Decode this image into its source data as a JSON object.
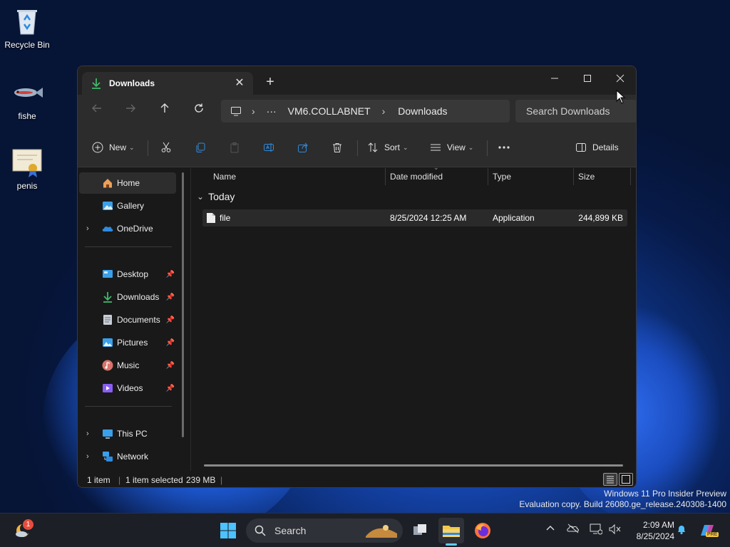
{
  "desktop": {
    "icons": [
      {
        "label": "Recycle Bin",
        "icon": "recycle-bin-icon"
      },
      {
        "label": "fishe",
        "icon": "fish-icon"
      },
      {
        "label": "penis",
        "icon": "certificate-icon"
      }
    ]
  },
  "window": {
    "tab_title": "Downloads",
    "address": {
      "computer": "VM6.COLLABNET",
      "folder": "Downloads",
      "overflow": "···"
    },
    "search_placeholder": "Search Downloads"
  },
  "toolbar": {
    "new_label": "New",
    "sort_label": "Sort",
    "view_label": "View",
    "details_label": "Details"
  },
  "sidebar": {
    "items": [
      {
        "label": "Home",
        "icon": "home-icon"
      },
      {
        "label": "Gallery",
        "icon": "gallery-icon"
      },
      {
        "label": "OneDrive",
        "icon": "onedrive-icon"
      },
      {
        "label": "Desktop",
        "icon": "desktop-icon",
        "pinned": true
      },
      {
        "label": "Downloads",
        "icon": "downloads-icon",
        "pinned": true
      },
      {
        "label": "Documents",
        "icon": "documents-icon",
        "pinned": true
      },
      {
        "label": "Pictures",
        "icon": "pictures-icon",
        "pinned": true
      },
      {
        "label": "Music",
        "icon": "music-icon",
        "pinned": true
      },
      {
        "label": "Videos",
        "icon": "videos-icon",
        "pinned": true
      },
      {
        "label": "This PC",
        "icon": "this-pc-icon"
      },
      {
        "label": "Network",
        "icon": "network-icon"
      }
    ]
  },
  "files": {
    "columns": [
      "Name",
      "Date modified",
      "Type",
      "Size"
    ],
    "group": "Today",
    "rows": [
      {
        "name": "file",
        "date": "8/25/2024 12:25 AM",
        "type": "Application",
        "size": "244,899 KB"
      }
    ]
  },
  "status": {
    "count": "1 item",
    "selected": "1 item selected",
    "size": "239 MB"
  },
  "watermark": {
    "line1": "Windows 11 Pro Insider Preview",
    "line2": "Evaluation copy. Build 26080.ge_release.240308-1400"
  },
  "taskbar": {
    "search_label": "Search",
    "time": "2:09 AM",
    "date": "8/25/2024",
    "widget_badge": "1",
    "copilot_badge": "PRE"
  },
  "colors": {
    "accent": "#1a73e8",
    "window_bg": "#191919",
    "toolbar_bg": "#2c2c2c"
  }
}
